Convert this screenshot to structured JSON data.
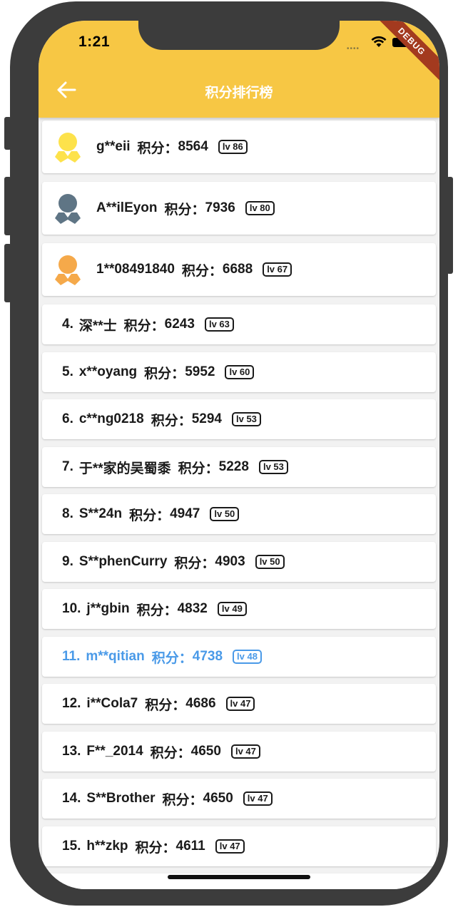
{
  "status_bar": {
    "time": "1:21",
    "debug_label": "DEBUG"
  },
  "app_bar": {
    "title": "积分排行榜",
    "back_icon": "arrow-left-icon"
  },
  "colors": {
    "app_bar": "#f7c744",
    "highlight": "#4a9ae8",
    "gold": "#fde24b",
    "silver": "#5f7585",
    "bronze": "#f5a94a"
  },
  "score_label": "积分：",
  "top3": [
    {
      "medal": "gold-medal-icon",
      "name": "g**eii",
      "score": "8564",
      "level": "lv 86"
    },
    {
      "medal": "silver-medal-icon",
      "name": "A**ilEyon",
      "score": "7936",
      "level": "lv 80"
    },
    {
      "medal": "bronze-medal-icon",
      "name": "1**08491840",
      "score": "6688",
      "level": "lv 67"
    }
  ],
  "ranks": [
    {
      "rank": "4.",
      "name": "深**士",
      "score": "6243",
      "level": "lv 63"
    },
    {
      "rank": "5.",
      "name": "x**oyang",
      "score": "5952",
      "level": "lv 60"
    },
    {
      "rank": "6.",
      "name": "c**ng0218",
      "score": "5294",
      "level": "lv 53"
    },
    {
      "rank": "7.",
      "name": "于**家的吴蜀黍",
      "score": "5228",
      "level": "lv 53"
    },
    {
      "rank": "8.",
      "name": "S**24n",
      "score": "4947",
      "level": "lv 50"
    },
    {
      "rank": "9.",
      "name": "S**phenCurry",
      "score": "4903",
      "level": "lv 50"
    },
    {
      "rank": "10.",
      "name": "j**gbin",
      "score": "4832",
      "level": "lv 49"
    },
    {
      "rank": "11.",
      "name": "m**qitian",
      "score": "4738",
      "level": "lv 48"
    },
    {
      "rank": "12.",
      "name": "i**Cola7",
      "score": "4686",
      "level": "lv 47"
    },
    {
      "rank": "13.",
      "name": "F**_2014",
      "score": "4650",
      "level": "lv 47"
    },
    {
      "rank": "14.",
      "name": "S**Brother",
      "score": "4650",
      "level": "lv 47"
    },
    {
      "rank": "15.",
      "name": "h**zkp",
      "score": "4611",
      "level": "lv 47"
    }
  ]
}
